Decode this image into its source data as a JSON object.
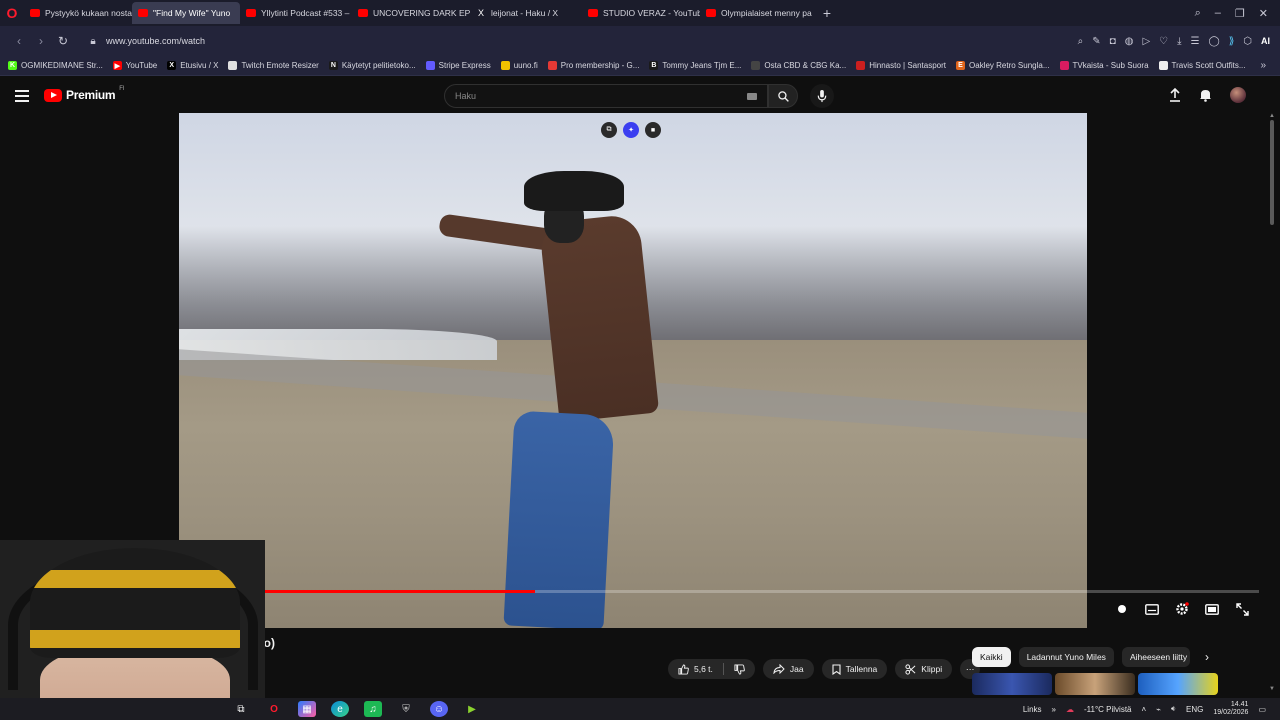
{
  "browser": {
    "tabs": [
      {
        "label": "Pystyykö kukaan nostam",
        "favicon": "youtube-icon",
        "active": false
      },
      {
        "label": "\"Find My Wife\" Yuno",
        "favicon": "youtube-icon",
        "active": true
      },
      {
        "label": "Yllytinti Podcast #533 – Ic",
        "favicon": "youtube-icon",
        "active": false
      },
      {
        "label": "UNCOVERING DARK EPST",
        "favicon": "youtube-icon",
        "active": false
      },
      {
        "label": "leijonat - Haku / X",
        "favicon": "x-icon",
        "active": false
      },
      {
        "label": "STUDIO VERAZ - YouTube",
        "favicon": "youtube-icon",
        "active": false
      },
      {
        "label": "Olympialaiset menny pah",
        "favicon": "youtube-icon",
        "active": false
      }
    ],
    "url": "www.youtube.com/watch",
    "ai_label": "AI",
    "bookmarks": [
      {
        "label": "OGMIKEDIMANE Str...",
        "color": "#53fc18",
        "glyph": "K"
      },
      {
        "label": "YouTube",
        "color": "#ff0000",
        "glyph": "▶"
      },
      {
        "label": "Etusivu / X",
        "color": "#000000",
        "glyph": "X"
      },
      {
        "label": "Twitch Emote Resizer",
        "color": "#e0e0e0",
        "glyph": ""
      },
      {
        "label": "Käytetyt pelitietoko...",
        "color": "#1a1a1a",
        "glyph": "N"
      },
      {
        "label": "Stripe Express",
        "color": "#635bff",
        "glyph": ""
      },
      {
        "label": "uuno.fi",
        "color": "#f2c200",
        "glyph": ""
      },
      {
        "label": "Pro membership - G...",
        "color": "#e53935",
        "glyph": ""
      },
      {
        "label": "Tommy Jeans Tjm E...",
        "color": "#1a1a1a",
        "glyph": "B"
      },
      {
        "label": "Osta CBD & CBG Ka...",
        "color": "#444444",
        "glyph": ""
      },
      {
        "label": "Hinnasto | Santasport",
        "color": "#cc1f1f",
        "glyph": ""
      },
      {
        "label": "Oakley Retro Sungla...",
        "color": "#e0651c",
        "glyph": "E"
      },
      {
        "label": "TVkaista - Sub Suora",
        "color": "#d81b60",
        "glyph": ""
      },
      {
        "label": "Travis Scott Outfits...",
        "color": "#eeeeee",
        "glyph": ""
      }
    ]
  },
  "youtube": {
    "logo_text": "Premium",
    "region": "FI",
    "search_placeholder": "Haku",
    "title_fragment": "eo)",
    "actions": {
      "like_count": "5,6 t.",
      "share": "Jaa",
      "save": "Tallenna",
      "clip": "Klippi"
    },
    "chips": [
      "Kaikki",
      "Ladannut Yuno Miles",
      "Aiheeseen liitty"
    ],
    "progress_fraction": 0.33
  },
  "taskbar": {
    "links_label": "Links",
    "weather": "-11°C  Pilvistä",
    "lang": "ENG",
    "time": "14.41",
    "date": "19/02/2026"
  }
}
